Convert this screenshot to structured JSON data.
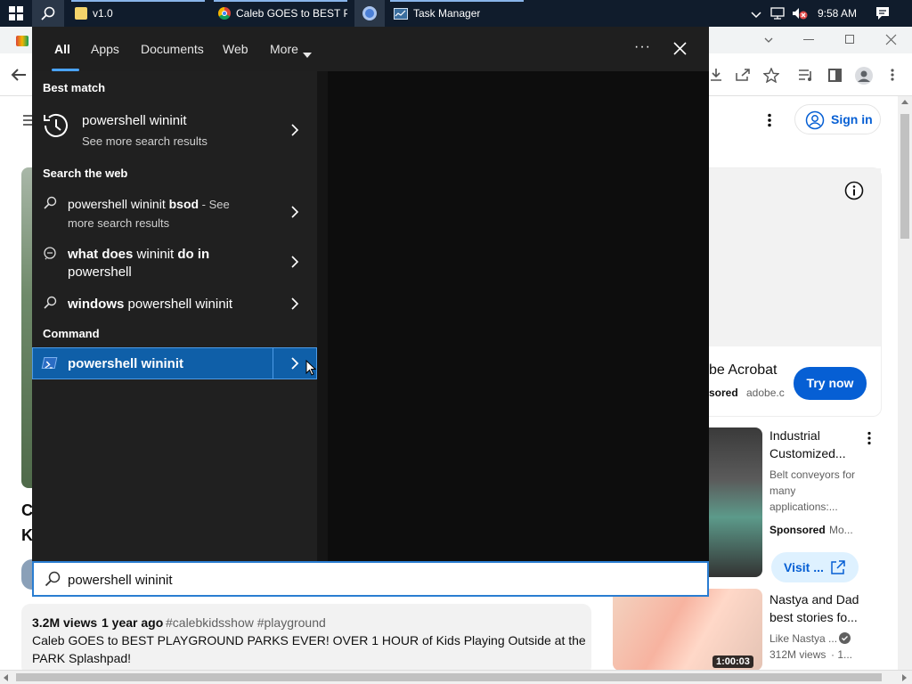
{
  "taskbar": {
    "explorer_label": "v1.0",
    "chrome_label": "Caleb GOES to BEST P...",
    "taskmgr_label": "Task Manager",
    "clock": "9:58 AM"
  },
  "search_flyout": {
    "tabs": [
      "All",
      "Apps",
      "Documents",
      "Web",
      "More"
    ],
    "more_dots": "···",
    "best_match_heading": "Best match",
    "best_match": {
      "title": "powershell wininit",
      "subtitle": "See more search results"
    },
    "web_heading": "Search the web",
    "web_results": [
      {
        "prefix": "powershell wininit ",
        "bold": "bsod",
        "suffix": " - See",
        "line2": "more search results"
      },
      {
        "bold1": "what does",
        "mid": " wininit ",
        "bold2": "do in",
        "line2": "powershell"
      },
      {
        "bold": "windows",
        "rest": " powershell wininit"
      }
    ],
    "command_heading": "Command",
    "command_result": "powershell wininit",
    "search_value": "powershell wininit"
  },
  "youtube": {
    "sign_in": "Sign in",
    "ad_title": "be Acrobat",
    "ad_sponsored": "sored",
    "ad_domain": "adobe.c",
    "try_now": "Try now",
    "rec1": {
      "title1": "Industrial",
      "title2": "Customized...",
      "desc1": "Belt conveyors for",
      "desc2": "many",
      "desc3": "applications:...",
      "sponsored": "Sponsored",
      "more": "Mo...",
      "visit": "Visit ..."
    },
    "rec2": {
      "title1": "Nastya and Dad",
      "title2": "best stories fo...",
      "channel": "Like Nastya ...",
      "views": "312M views",
      "dot": "· 1...",
      "duration": "1:00:03"
    },
    "video_meta_views": "3.2M views",
    "video_meta_age": "1 year ago",
    "video_meta_tags": "#calebkidsshow #playground",
    "desc_line1": "Caleb GOES to BEST PLAYGROUND PARKS EVER! OVER 1 HOUR of Kids Playing Outside at the",
    "desc_line2": "PARK Splashpad!",
    "title_frag1": "C",
    "title_frag2": "K"
  }
}
